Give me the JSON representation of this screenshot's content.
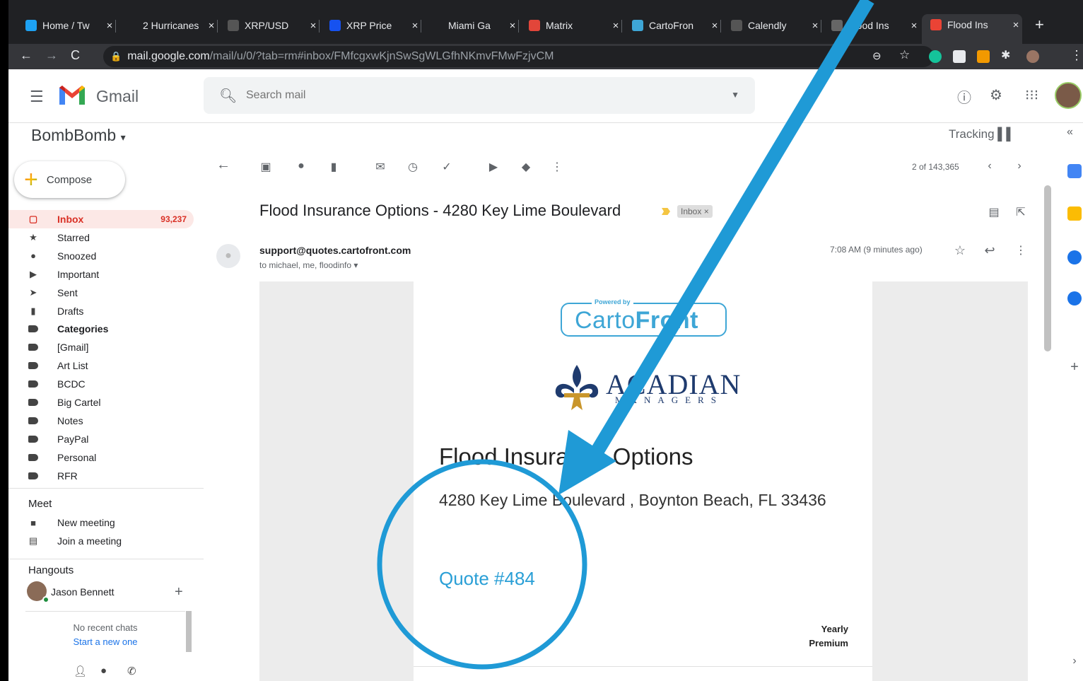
{
  "browser": {
    "tabs": [
      {
        "title": "Home / Tw",
        "favicon": "twitter-bird",
        "color": "#1da1f2"
      },
      {
        "title": "2 Hurricanes",
        "favicon": "icon-e",
        "color": "#202124"
      },
      {
        "title": "XRP/USD",
        "favicon": "fx-icon",
        "color": "#555"
      },
      {
        "title": "XRP Price",
        "favicon": "c-icon",
        "color": "#1652f0"
      },
      {
        "title": "Miami Ga",
        "favicon": "c-icon",
        "color": "#202124"
      },
      {
        "title": "Matrix",
        "favicon": "matrix-icon",
        "color": "#e2463a"
      },
      {
        "title": "CartoFron",
        "favicon": "cartofront-icon",
        "color": "#3ea6d6"
      },
      {
        "title": "Calendly",
        "favicon": "calendly-icon",
        "color": "#555"
      },
      {
        "title": "Flood Ins",
        "favicon": "globe-icon",
        "color": "#666"
      },
      {
        "title": "Flood Ins",
        "favicon": "gmail-icon",
        "color": "#ea4335"
      }
    ],
    "close_glyph": "×",
    "new_tab_glyph": "+",
    "url_host": "mail.google.com",
    "url_path": "/mail/u/0/?tab=rm#inbox/FMfcgxwKjnSwSgWLGfhNKmvFMwFzjvCM"
  },
  "gmail": {
    "logo_text": "Gmail",
    "search_placeholder": "Search mail",
    "account_name": "BombBomb",
    "tracking_label": "Tracking",
    "compose_label": "Compose",
    "nav": [
      {
        "label": "Inbox",
        "count": "93,237",
        "icon": "inbox-icon",
        "active": true,
        "bold": true
      },
      {
        "label": "Starred",
        "count": "",
        "icon": "star-icon"
      },
      {
        "label": "Snoozed",
        "count": "",
        "icon": "clock-icon"
      },
      {
        "label": "Important",
        "count": "",
        "icon": "important-icon"
      },
      {
        "label": "Sent",
        "count": "",
        "icon": "send-icon"
      },
      {
        "label": "Drafts",
        "count": "",
        "icon": "draft-icon"
      },
      {
        "label": "Categories",
        "count": "",
        "icon": "label-icon",
        "bold": true
      },
      {
        "label": "[Gmail]",
        "count": "",
        "icon": "label-icon"
      },
      {
        "label": "Art List",
        "count": "",
        "icon": "label-icon"
      },
      {
        "label": "BCDC",
        "count": "",
        "icon": "label-icon"
      },
      {
        "label": "Big Cartel",
        "count": "",
        "icon": "label-icon"
      },
      {
        "label": "Notes",
        "count": "",
        "icon": "label-icon"
      },
      {
        "label": "PayPal",
        "count": "",
        "icon": "label-icon"
      },
      {
        "label": "Personal",
        "count": "",
        "icon": "label-icon"
      },
      {
        "label": "RFR",
        "count": "",
        "icon": "label-icon"
      }
    ],
    "meet": {
      "heading": "Meet",
      "new_meeting": "New meeting",
      "join_meeting": "Join a meeting"
    },
    "hangouts": {
      "heading": "Hangouts",
      "contact": "Jason Bennett",
      "no_chats": "No recent chats",
      "start_new": "Start a new one"
    },
    "page_count": "2 of 143,365"
  },
  "email": {
    "subject": "Flood Insurance Options - 4280 Key Lime Boulevard",
    "inbox_chip": "Inbox ×",
    "sender": "support@quotes.cartofront.com",
    "recipients": "to michael, me, floodinfo",
    "time": "7:08 AM (9 minutes ago)",
    "body": {
      "powered_by": "Powered by",
      "brand_carto": "Carto",
      "brand_front": "Front",
      "acadian": "ACADIAN",
      "managers": "MANAGERS",
      "title": "Flood Insurance Options",
      "address": "4280 Key Lime Boulevard , Boynton Beach, FL 33436",
      "quote": "Quote #484",
      "yearly": "Yearly",
      "premium": "Premium"
    }
  },
  "annotation": {
    "arrow_color": "#1f9ad6",
    "circle_color": "#1f9ad6"
  }
}
